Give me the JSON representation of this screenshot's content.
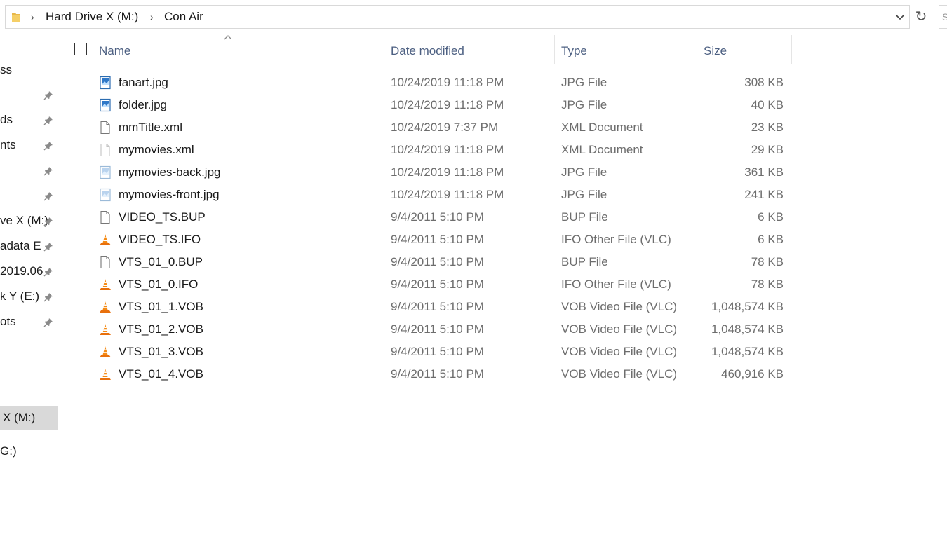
{
  "address_bar": {
    "breadcrumbs": [
      "Hard Drive X (M:)",
      "Con Air"
    ],
    "folder_icon": "folder-icon",
    "dropdown_icon": "chevron-down-icon",
    "refresh_icon": "refresh-icon"
  },
  "nav": {
    "items": [
      {
        "label": "ss",
        "pinned": false
      },
      {
        "label": "",
        "pinned": true
      },
      {
        "label": "ds",
        "pinned": true
      },
      {
        "label": "nts",
        "pinned": true
      },
      {
        "label": "",
        "pinned": true
      },
      {
        "label": "",
        "pinned": true
      },
      {
        "label": "ve X (M:)",
        "pinned": true
      },
      {
        "label": "adata E",
        "pinned": true
      },
      {
        "label": "2019.06",
        "pinned": true
      },
      {
        "label": "k Y (E:)",
        "pinned": true
      },
      {
        "label": "ots",
        "pinned": true
      },
      {
        "label": "X (M:)",
        "pinned": false,
        "selected": true
      },
      {
        "label": "G:)",
        "pinned": false
      }
    ]
  },
  "columns": {
    "name": "Name",
    "date_modified": "Date modified",
    "type": "Type",
    "size": "Size"
  },
  "files": [
    {
      "name": "fanart.jpg",
      "date": "10/24/2019 11:18 PM",
      "type": "JPG File",
      "size": "308 KB",
      "icon": "image-file-icon"
    },
    {
      "name": "folder.jpg",
      "date": "10/24/2019 11:18 PM",
      "type": "JPG File",
      "size": "40 KB",
      "icon": "image-file-icon"
    },
    {
      "name": "mmTitle.xml",
      "date": "10/24/2019 7:37 PM",
      "type": "XML Document",
      "size": "23 KB",
      "icon": "document-icon"
    },
    {
      "name": "mymovies.xml",
      "date": "10/24/2019 11:18 PM",
      "type": "XML Document",
      "size": "29 KB",
      "icon": "document-icon-faded"
    },
    {
      "name": "mymovies-back.jpg",
      "date": "10/24/2019 11:18 PM",
      "type": "JPG File",
      "size": "361 KB",
      "icon": "image-file-icon-faded"
    },
    {
      "name": "mymovies-front.jpg",
      "date": "10/24/2019 11:18 PM",
      "type": "JPG File",
      "size": "241 KB",
      "icon": "image-file-icon-faded"
    },
    {
      "name": "VIDEO_TS.BUP",
      "date": "9/4/2011 5:10 PM",
      "type": "BUP File",
      "size": "6 KB",
      "icon": "document-icon"
    },
    {
      "name": "VIDEO_TS.IFO",
      "date": "9/4/2011 5:10 PM",
      "type": "IFO Other File (VLC)",
      "size": "6 KB",
      "icon": "vlc-cone-icon"
    },
    {
      "name": "VTS_01_0.BUP",
      "date": "9/4/2011 5:10 PM",
      "type": "BUP File",
      "size": "78 KB",
      "icon": "document-icon"
    },
    {
      "name": "VTS_01_0.IFO",
      "date": "9/4/2011 5:10 PM",
      "type": "IFO Other File (VLC)",
      "size": "78 KB",
      "icon": "vlc-cone-icon"
    },
    {
      "name": "VTS_01_1.VOB",
      "date": "9/4/2011 5:10 PM",
      "type": "VOB Video File (VLC)",
      "size": "1,048,574 KB",
      "icon": "vlc-cone-icon"
    },
    {
      "name": "VTS_01_2.VOB",
      "date": "9/4/2011 5:10 PM",
      "type": "VOB Video File (VLC)",
      "size": "1,048,574 KB",
      "icon": "vlc-cone-icon"
    },
    {
      "name": "VTS_01_3.VOB",
      "date": "9/4/2011 5:10 PM",
      "type": "VOB Video File (VLC)",
      "size": "1,048,574 KB",
      "icon": "vlc-cone-icon"
    },
    {
      "name": "VTS_01_4.VOB",
      "date": "9/4/2011 5:10 PM",
      "type": "VOB Video File (VLC)",
      "size": "460,916 KB",
      "icon": "vlc-cone-icon"
    }
  ]
}
